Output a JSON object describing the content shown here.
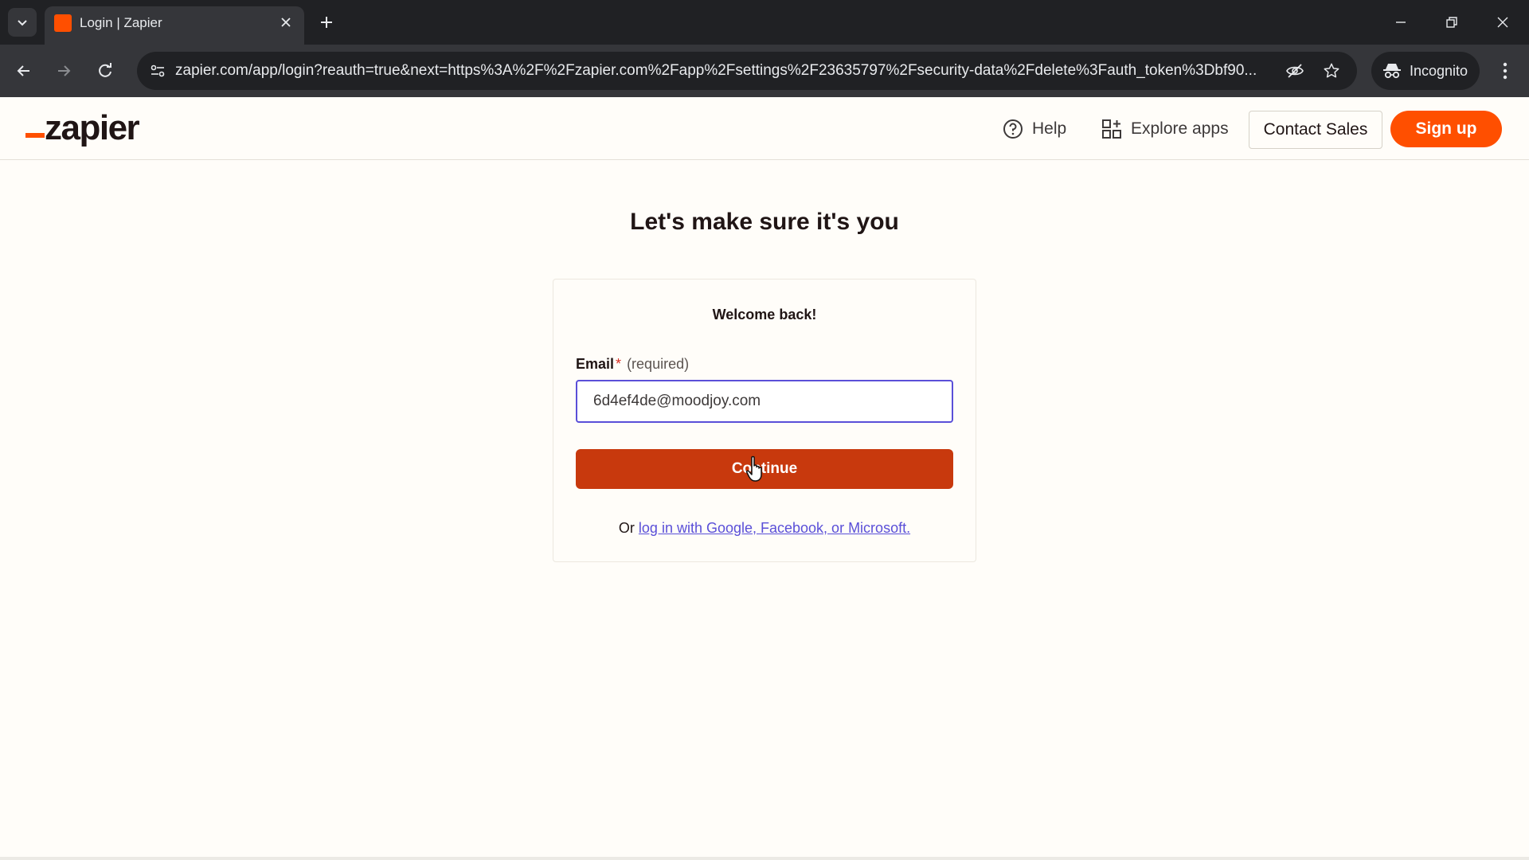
{
  "browser": {
    "tab_title": "Login | Zapier",
    "url": "zapier.com/app/login?reauth=true&next=https%3A%2F%2Fzapier.com%2Fapp%2Fsettings%2F23635797%2Fsecurity-data%2Fdelete%3Fauth_token%3Dbf90...",
    "incognito_label": "Incognito",
    "icons": [
      "tab-list-icon",
      "close-icon",
      "plus-icon",
      "minimize-icon",
      "restore-icon",
      "back-arrow-icon",
      "forward-arrow-icon",
      "reload-icon",
      "site-info-icon",
      "eye-off-icon",
      "star-icon",
      "incognito-icon",
      "kebab-menu-icon"
    ]
  },
  "header": {
    "logo_text": "zapier",
    "help_label": "Help",
    "explore_label": "Explore apps",
    "contact_label": "Contact Sales",
    "signup_label": "Sign up",
    "brand_color": "#ff4f00"
  },
  "main": {
    "heading": "Let's make sure it's you",
    "card_title": "Welcome back!",
    "email_label": "Email",
    "required_star": "*",
    "required_text": "(required)",
    "email_value": "6d4ef4de@moodjoy.com",
    "continue_label": "Continue",
    "alt_prefix": "Or",
    "alt_link": "log in with Google, Facebook, or Microsoft.",
    "continue_color": "#c8390d",
    "link_color": "#5a4fd8"
  }
}
